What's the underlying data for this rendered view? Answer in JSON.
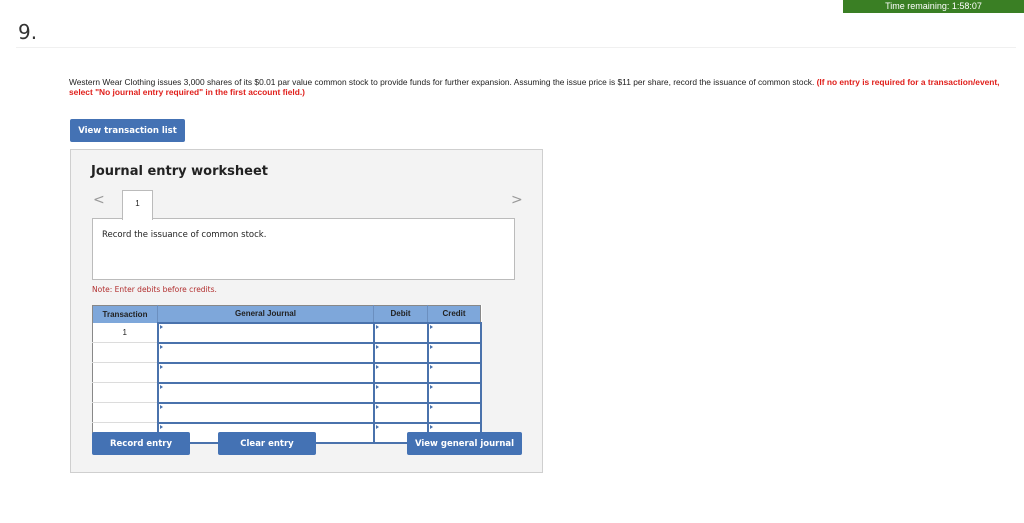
{
  "timer": {
    "label": "Time remaining: 1:58:07"
  },
  "question": {
    "number": "9.",
    "prompt_text": "Western Wear Clothing issues 3,000 shares of its $0.01 par value common stock to provide funds for further expansion. Assuming the issue price is $11 per share, record the issuance of common stock. ",
    "prompt_instruction": "(If no entry is required for a transaction/event, select \"No journal entry required\" in the first account field.)"
  },
  "buttons": {
    "view_transaction_list": "View transaction list",
    "record_entry": "Record entry",
    "clear_entry": "Clear entry",
    "view_general_journal": "View general journal"
  },
  "worksheet": {
    "title": "Journal entry worksheet",
    "nav_prev": "<",
    "nav_next": ">",
    "tabs": [
      {
        "label": "1"
      }
    ],
    "description": "Record the issuance of common stock.",
    "note": "Note: Enter debits before credits.",
    "table": {
      "headers": [
        "Transaction",
        "General Journal",
        "Debit",
        "Credit"
      ],
      "rows": [
        {
          "transaction": "1",
          "account": "",
          "debit": "",
          "credit": ""
        },
        {
          "transaction": "",
          "account": "",
          "debit": "",
          "credit": ""
        },
        {
          "transaction": "",
          "account": "",
          "debit": "",
          "credit": ""
        },
        {
          "transaction": "",
          "account": "",
          "debit": "",
          "credit": ""
        },
        {
          "transaction": "",
          "account": "",
          "debit": "",
          "credit": ""
        },
        {
          "transaction": "",
          "account": "",
          "debit": "",
          "credit": ""
        }
      ]
    }
  },
  "colors": {
    "timer_bg": "#3a7f24",
    "button_bg": "#4472b4",
    "header_bg": "#7ea7da",
    "instruction_red": "#e0201c",
    "note_red": "#b23030"
  }
}
